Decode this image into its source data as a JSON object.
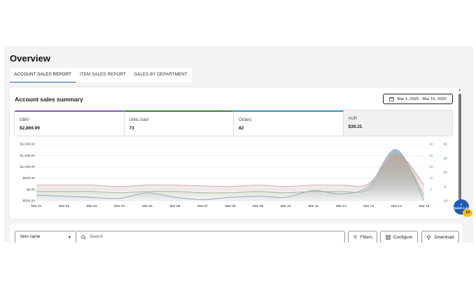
{
  "page": {
    "title": "Overview"
  },
  "tabs": [
    {
      "label": "ACCOUNT SALES REPORT",
      "active": true
    },
    {
      "label": "ITEM SALES REPORT",
      "active": false
    },
    {
      "label": "SALES BY DEPARTMENT",
      "active": false
    }
  ],
  "summary": {
    "title": "Account sales summary",
    "date_range": "Mar 1, 2025 - Mar 16, 2025",
    "metrics": [
      {
        "label": "GMV",
        "value": "$2,869.99",
        "color": "#8c63c4"
      },
      {
        "label": "Units Sold",
        "value": "73",
        "color": "#3f8f3b"
      },
      {
        "label": "Orders",
        "value": "82",
        "color": "#3b9bd1"
      },
      {
        "label": "AUR",
        "value": "$39.31",
        "color": ""
      }
    ]
  },
  "chart_data": {
    "type": "area",
    "categories": [
      "Mar 01",
      "Mar 02",
      "Mar 03",
      "Mar 04",
      "Mar 05",
      "Mar 06",
      "Mar 07",
      "Mar 08",
      "Mar 09",
      "Mar 10",
      "Mar 11",
      "Mar 12",
      "Mar 13",
      "Mar 14",
      "Mar 15"
    ],
    "y_left_ticks": [
      "$2,000.00",
      "$1,500.00",
      "$1,000.00",
      "$500.00",
      "$0.00",
      "-$500.00"
    ],
    "y_left_range": [
      -500,
      2000
    ],
    "y_mid_ticks": [
      "40",
      "30",
      "20",
      "10",
      "0"
    ],
    "y_mid_range": [
      -3,
      40
    ],
    "y_right_ticks": [
      "60",
      "40",
      "20",
      "0",
      "-20"
    ],
    "y_right_range": [
      -20,
      60
    ],
    "series": [
      {
        "color": "#7fa2c4",
        "axis": "left",
        "values": [
          -250,
          -300,
          -350,
          -400,
          -150,
          -350,
          -450,
          -350,
          -300,
          -350,
          -50,
          -200,
          150,
          1750,
          -500
        ]
      },
      {
        "color": "#8fb68c",
        "axis": "mid",
        "values": [
          4,
          4,
          4,
          3,
          4,
          4,
          3,
          3,
          4,
          3,
          4,
          4,
          6,
          33,
          1
        ]
      },
      {
        "color": "#c9a7a7",
        "axis": "right",
        "values": [
          2,
          2,
          2,
          0,
          2,
          2,
          1,
          0,
          2,
          0,
          2,
          2,
          4,
          46,
          2
        ]
      }
    ]
  },
  "side": {
    "quick_label": "Quick Lau",
    "badge": "18"
  },
  "toolbar": {
    "item_select": "Item name",
    "search_placeholder": "Search",
    "filters": "Filters",
    "configure": "Configure",
    "download": "Download"
  }
}
